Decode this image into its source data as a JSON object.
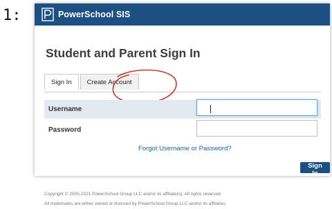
{
  "step_label": "1:",
  "header": {
    "brand": "PowerSchool SIS",
    "logo_icon": "powerschool-logo"
  },
  "page_title": "Student and Parent Sign In",
  "tabs": [
    {
      "label": "Sign In",
      "active": true
    },
    {
      "label": "Create Account",
      "active": false,
      "highlighted": true
    }
  ],
  "form": {
    "username_label": "Username",
    "username_value": "",
    "password_label": "Password",
    "password_value": "",
    "forgot_link": "Forgot Username or Password?",
    "submit_label": "Sign In"
  },
  "footer": {
    "copyright": "Copyright © 2005-2021 PowerSchool Group LLC and/or its affiliate(s). All rights reserved.",
    "trademark": "All trademarks are either owned or licensed by PowerSchool Group LLC and/or its affiliates."
  },
  "colors": {
    "header_bg": "#1c4f82",
    "annotation_circle": "#c0392b",
    "link": "#1c5ea5",
    "username_row_bg": "#e3e9f0"
  }
}
